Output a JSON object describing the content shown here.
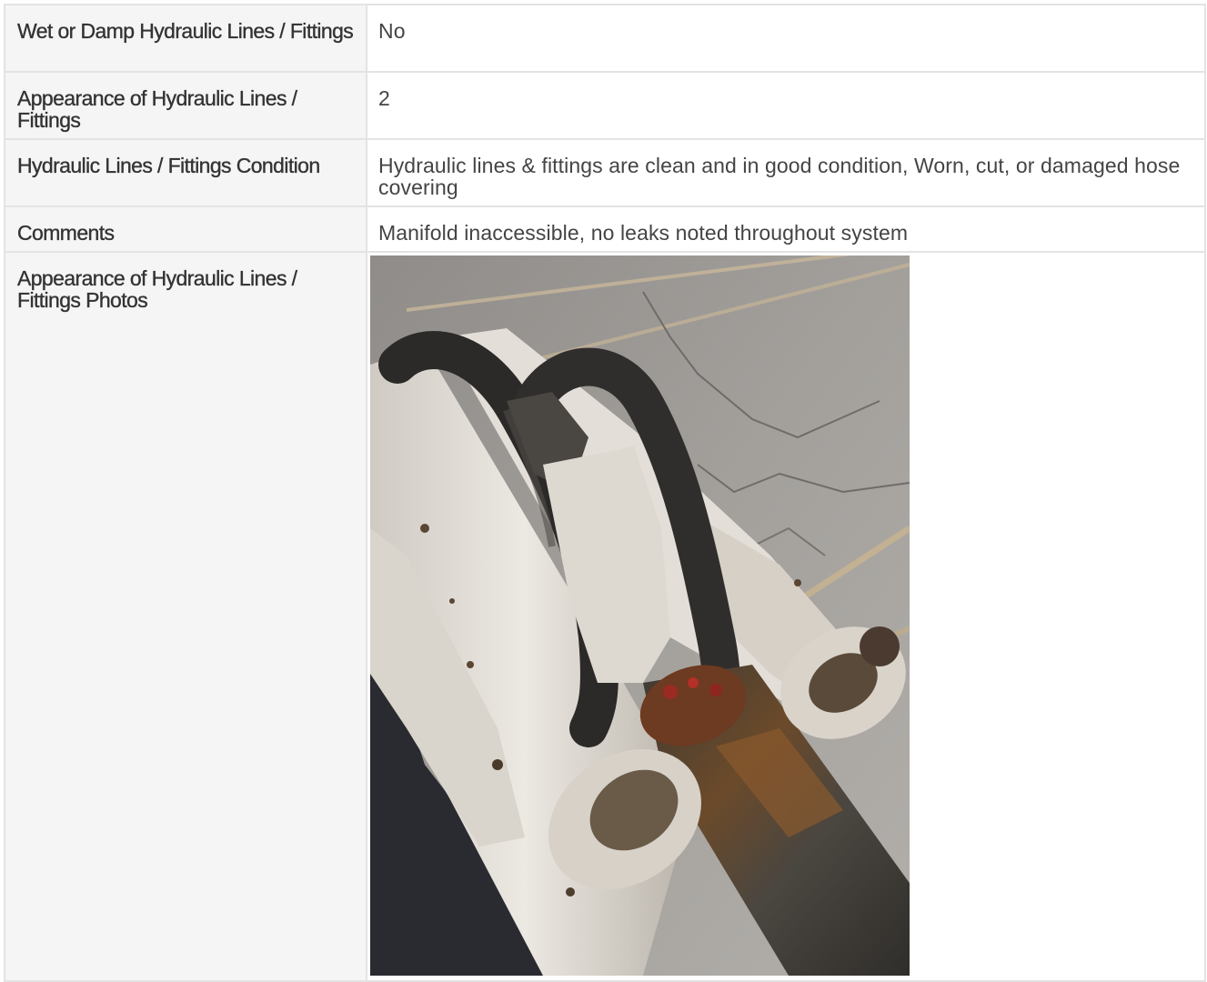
{
  "rows": [
    {
      "label": "Wet or Damp Hydraulic Lines / Fittings",
      "value": "No"
    },
    {
      "label": "Appearance of Hydraulic Lines / Fittings",
      "value": "2"
    },
    {
      "label": "Hydraulic Lines / Fittings Condition",
      "value": "Hydraulic lines & fittings are clean and in good condition, Worn, cut, or damaged hose covering"
    },
    {
      "label": "Comments",
      "value": "Manifold inaccessible, no leaks noted throughout system"
    }
  ],
  "photo_row": {
    "label": "Appearance of Hydraulic Lines / Fittings Photos"
  },
  "colors": {
    "label_background": "#f5f5f5",
    "border": "#e3e3e3",
    "text": "#333333"
  }
}
